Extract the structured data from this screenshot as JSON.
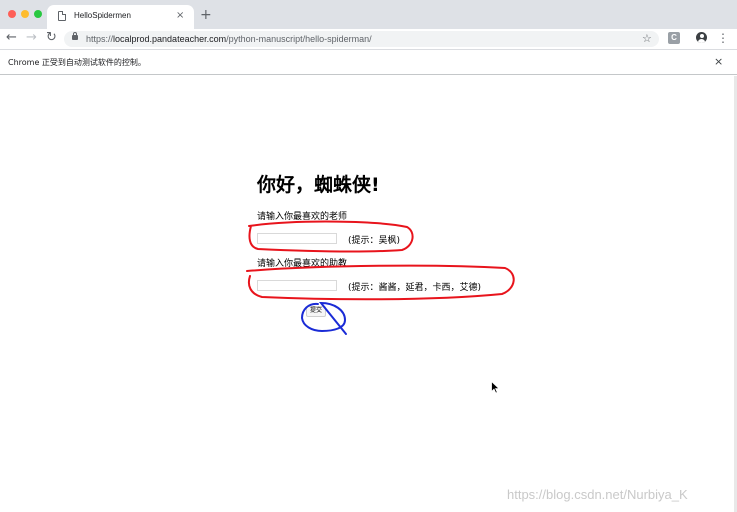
{
  "browser": {
    "tab_title": "HelloSpidermen",
    "tab_close": "×",
    "new_tab": "+",
    "url_scheme": "https://",
    "url_host": "localprod.pandateacher.com",
    "url_path": "/python-manuscript/hello-spiderman/",
    "extension_badge": "C",
    "infobar_text": "Chrome 正受到自动测试软件的控制。",
    "infobar_close": "×",
    "colors": {
      "tabstrip": "#dee1e6",
      "omnibox": "#f1f3f4",
      "traffic_red": "#fe5f57",
      "traffic_yellow": "#febc2e",
      "traffic_green": "#28c840"
    }
  },
  "page": {
    "heading": "你好，蜘蛛侠!",
    "teacher_label": "请输入你最喜欢的老师",
    "teacher_value": "",
    "teacher_hint": "(提示：吴枫)",
    "assistant_label": "请输入你最喜欢的助教",
    "assistant_value": "",
    "assistant_hint": "(提示：酱酱，延君，卡西，艾德)",
    "submit_label": "提交"
  },
  "annotations": {
    "red_marker_color": "#e8141c",
    "blue_marker_color": "#1a2bd6"
  },
  "watermark": "https://blog.csdn.net/Nurbiya_K"
}
